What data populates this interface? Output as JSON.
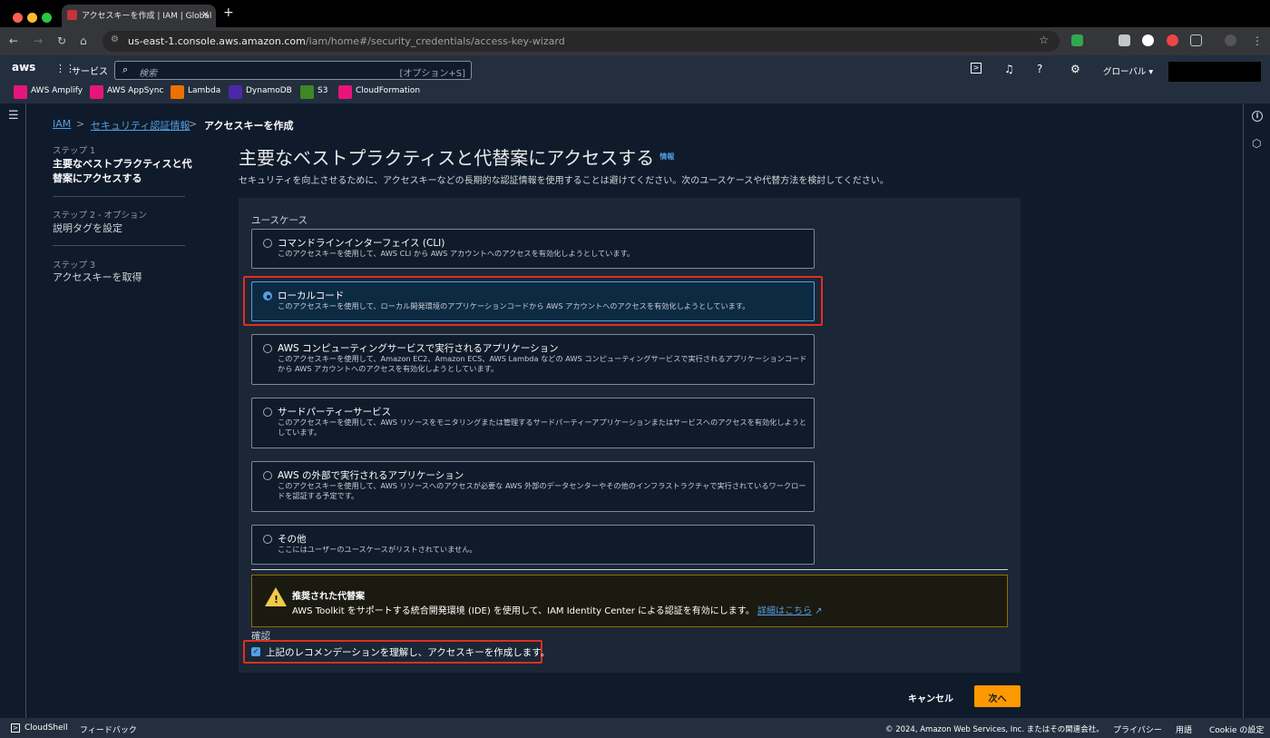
{
  "browser": {
    "tab_title": "アクセスキーを作成 | IAM | Global",
    "tab_close": "×",
    "new_tab": "+",
    "url_host": "us-east-1.console.aws.amazon.com",
    "url_path": "/iam/home#/security_credentials/access-key-wizard"
  },
  "aws_nav": {
    "logo": "aws",
    "services": "サービス",
    "search_placeholder": "検索",
    "search_shortcut": "[オプション+S]",
    "region": "グローバル ▾"
  },
  "favorites": [
    {
      "label": "AWS Amplify",
      "color": "#e7157b"
    },
    {
      "label": "AWS AppSync",
      "color": "#e7157b"
    },
    {
      "label": "Lambda",
      "color": "#ed7100"
    },
    {
      "label": "DynamoDB",
      "color": "#4d27aa"
    },
    {
      "label": "S3",
      "color": "#3f8624"
    },
    {
      "label": "CloudFormation",
      "color": "#e7157b"
    }
  ],
  "breadcrumb": {
    "iam": "IAM",
    "security": "セキュリティ認証情報",
    "current": "アクセスキーを作成",
    "sep": ">"
  },
  "steps": [
    {
      "num": "ステップ 1",
      "label1": "主要なベストプラクティスと代",
      "label2": "替案にアクセスする"
    },
    {
      "num": "ステップ 2 - オプション",
      "label1": "説明タグを設定"
    },
    {
      "num": "ステップ 3",
      "label1": "アクセスキーを取得"
    }
  ],
  "page": {
    "title": "主要なベストプラクティスと代替案にアクセスする",
    "info": "情報",
    "description": "セキュリティを向上させるために、アクセスキーなどの長期的な認証情報を使用することは避けてください。次のユースケースや代替方法を検討してください。",
    "use_case_label": "ユースケース"
  },
  "options": [
    {
      "title": "コマンドラインインターフェイス (CLI)",
      "desc": "このアクセスキーを使用して、AWS CLI から AWS アカウントへのアクセスを有効化しようとしています。"
    },
    {
      "title": "ローカルコード",
      "desc": "このアクセスキーを使用して、ローカル開発環境のアプリケーションコードから AWS アカウントへのアクセスを有効化しようとしています。"
    },
    {
      "title": "AWS コンピューティングサービスで実行されるアプリケーション",
      "desc": "このアクセスキーを使用して、Amazon EC2、Amazon ECS、AWS Lambda などの AWS コンピューティングサービスで実行されるアプリケーションコードから AWS アカウントへのアクセスを有効化しようとしています。"
    },
    {
      "title": "サードパーティーサービス",
      "desc": "このアクセスキーを使用して、AWS リソースをモニタリングまたは管理するサードパーティーアプリケーションまたはサービスへのアクセスを有効化しようとしています。"
    },
    {
      "title": "AWS の外部で実行されるアプリケーション",
      "desc": "このアクセスキーを使用して、AWS リソースへのアクセスが必要な AWS 外部のデータセンターやその他のインフラストラクチャで実行されているワークロードを認証する予定です。"
    },
    {
      "title": "その他",
      "desc": "ここにはユーザーのユースケースがリストされていません。"
    }
  ],
  "alert": {
    "title": "推奨された代替案",
    "desc": "AWS Toolkit をサポートする統合開発環境 (IDE) を使用して、IAM Identity Center による認証を有効にします。",
    "link": "詳細はこちら"
  },
  "confirm": {
    "label": "確認",
    "checkbox_text": "上記のレコメンデーションを理解し、アクセスキーを作成します。",
    "checked": true
  },
  "actions": {
    "cancel": "キャンセル",
    "next": "次へ"
  },
  "footer": {
    "cloudshell": "CloudShell",
    "feedback": "フィードバック",
    "copyright": "© 2024, Amazon Web Services, Inc. またはその関連会社。",
    "privacy": "プライバシー",
    "terms": "用語",
    "cookie": "Cookie の設定"
  },
  "colors": {
    "accent": "#539fe5",
    "primary_button": "#ff9900",
    "highlight_border": "#e02f1f"
  }
}
